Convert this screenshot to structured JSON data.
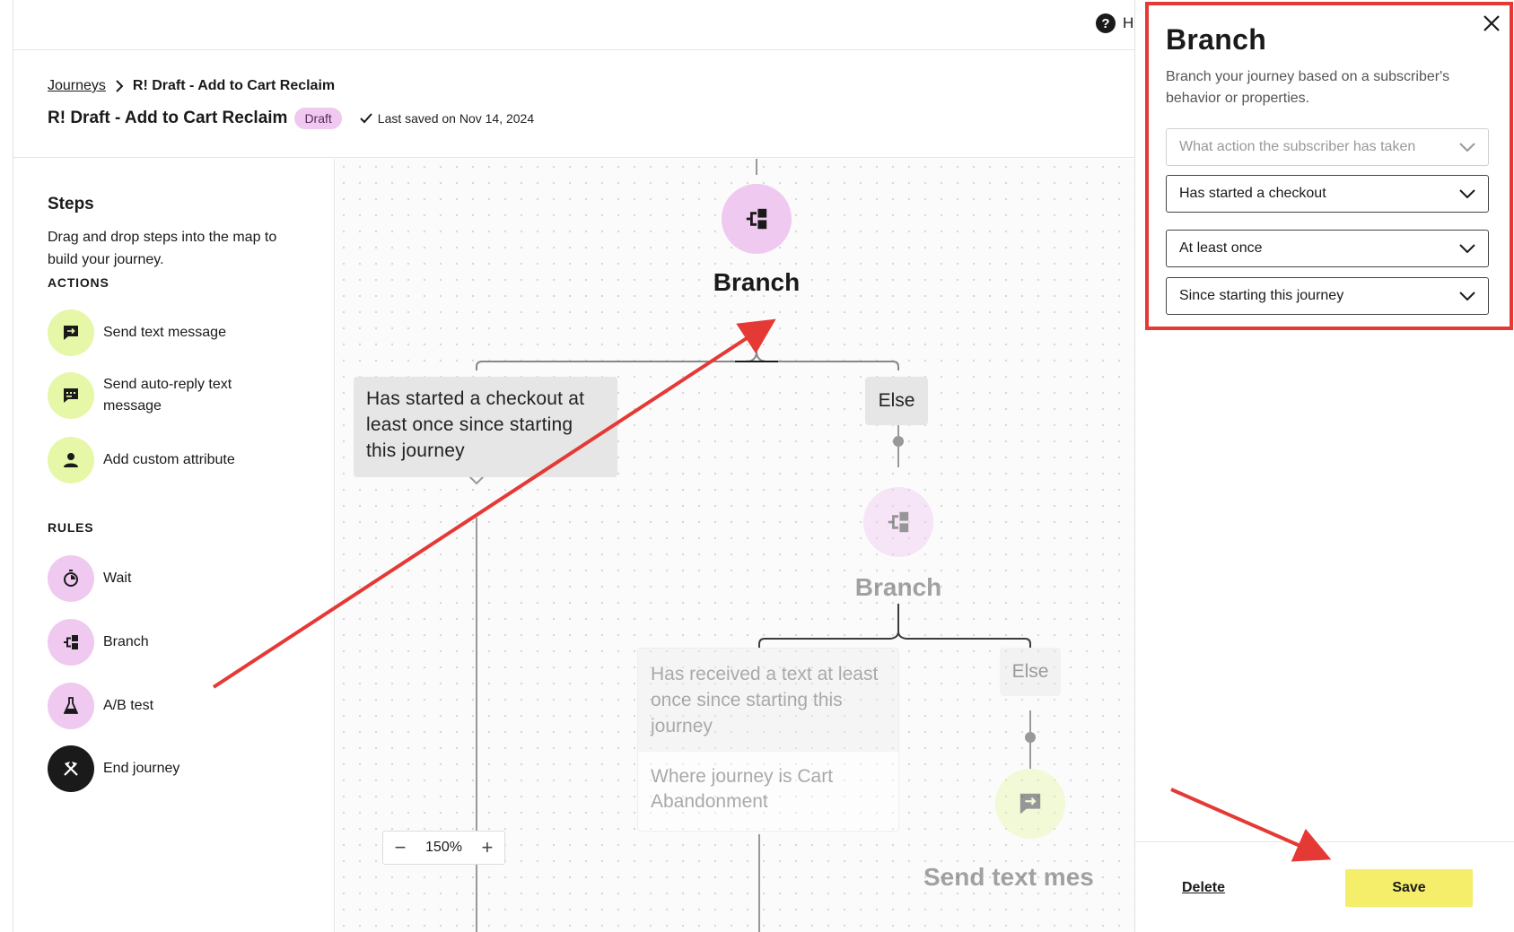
{
  "topbar": {
    "help_label": "H"
  },
  "breadcrumb": {
    "root": "Journeys",
    "current": "R! Draft - Add to Cart Reclaim"
  },
  "journey": {
    "title": "R! Draft - Add to Cart Reclaim",
    "status": "Draft",
    "saved_text": "Last saved on Nov 14, 2024"
  },
  "sidebar": {
    "title": "Steps",
    "description": "Drag and drop steps into the map to build your journey.",
    "actions_label": "ACTIONS",
    "actions": [
      {
        "label": "Send text message",
        "icon": "message-icon"
      },
      {
        "label": "Send auto-reply text message",
        "icon": "auto-reply-icon"
      },
      {
        "label": "Add custom attribute",
        "icon": "person-icon"
      }
    ],
    "rules_label": "RULES",
    "rules": [
      {
        "label": "Wait",
        "icon": "timer-icon"
      },
      {
        "label": "Branch",
        "icon": "branch-icon"
      },
      {
        "label": "A/B test",
        "icon": "flask-icon"
      },
      {
        "label": "End journey",
        "icon": "end-icon"
      }
    ]
  },
  "canvas": {
    "branch1": {
      "title": "Branch"
    },
    "condition1": "Has started a checkout at least once since starting this journey",
    "else1": "Else",
    "branch2": {
      "title": "Branch"
    },
    "condition2_top": "Has received a text at least once since starting this journey",
    "condition2_bottom": "Where journey is Cart Abandonment",
    "else2": "Else",
    "send_text_label": "Send text mes",
    "zoom": "150%"
  },
  "panel": {
    "title": "Branch",
    "description": "Branch your journey based on a subscriber's behavior or properties.",
    "select_action_placeholder": "What action the subscriber has taken",
    "select_event": "Has started a checkout",
    "select_frequency": "At least once",
    "select_timeframe": "Since starting this journey",
    "delete_label": "Delete",
    "save_label": "Save"
  },
  "colors": {
    "accent_yellow": "#f5ee6a",
    "branch_pink": "#efc9ef",
    "action_green": "#e6f7a8",
    "annotation_red": "#e53935"
  }
}
